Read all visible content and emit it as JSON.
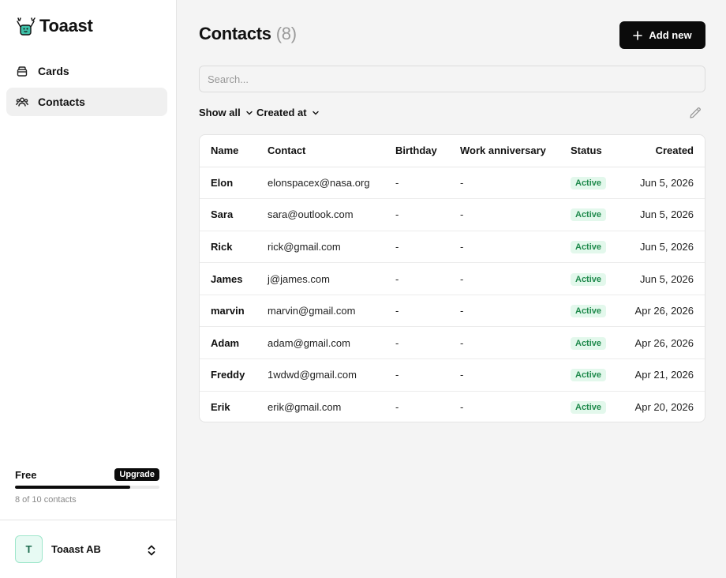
{
  "app": {
    "name": "Toaast"
  },
  "sidebar": {
    "items": [
      {
        "label": "Cards",
        "icon": "cards-icon",
        "active": false
      },
      {
        "label": "Contacts",
        "icon": "users-icon",
        "active": true
      }
    ],
    "plan": {
      "name": "Free",
      "upgrade_label": "Upgrade",
      "caption": "8 of 10 contacts",
      "usage_fraction": 0.8
    },
    "org": {
      "initial": "T",
      "name": "Toaast AB"
    }
  },
  "header": {
    "title": "Contacts",
    "count": "(8)",
    "add_label": "Add new"
  },
  "search": {
    "placeholder": "Search..."
  },
  "filters": {
    "show": "Show all",
    "sort": "Created at"
  },
  "table": {
    "columns": [
      "Name",
      "Contact",
      "Birthday",
      "Work anniversary",
      "Status",
      "Created"
    ],
    "rows": [
      {
        "name": "Elon",
        "contact": "elonspacex@nasa.org",
        "birthday": "-",
        "work": "-",
        "status": "Active",
        "created": "Jun 5, 2026"
      },
      {
        "name": "Sara",
        "contact": "sara@outlook.com",
        "birthday": "-",
        "work": "-",
        "status": "Active",
        "created": "Jun 5, 2026"
      },
      {
        "name": "Rick",
        "contact": "rick@gmail.com",
        "birthday": "-",
        "work": "-",
        "status": "Active",
        "created": "Jun 5, 2026"
      },
      {
        "name": "James",
        "contact": "j@james.com",
        "birthday": "-",
        "work": "-",
        "status": "Active",
        "created": "Jun 5, 2026"
      },
      {
        "name": "marvin",
        "contact": "marvin@gmail.com",
        "birthday": "-",
        "work": "-",
        "status": "Active",
        "created": "Apr 26, 2026"
      },
      {
        "name": "Adam",
        "contact": "adam@gmail.com",
        "birthday": "-",
        "work": "-",
        "status": "Active",
        "created": "Apr 26, 2026"
      },
      {
        "name": "Freddy",
        "contact": "1wdwd@gmail.com",
        "birthday": "-",
        "work": "-",
        "status": "Active",
        "created": "Apr 21, 2026"
      },
      {
        "name": "Erik",
        "contact": "erik@gmail.com",
        "birthday": "-",
        "work": "-",
        "status": "Active",
        "created": "Apr 20, 2026"
      }
    ]
  },
  "colors": {
    "primary": "#0b0b0b",
    "active_badge_bg": "#e3f8ec",
    "active_badge_text": "#1f8a4c",
    "avatar_bg": "#e7faf3",
    "logo_teal": "#3fc0a8"
  }
}
